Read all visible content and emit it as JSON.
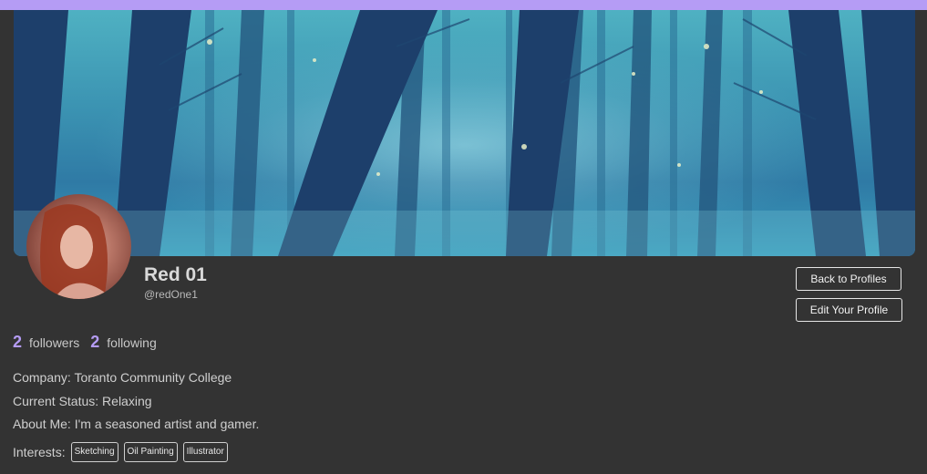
{
  "profile": {
    "name": "Red 01",
    "handle": "@redOne1",
    "followers_count": "2",
    "followers_label": "followers",
    "following_count": "2",
    "following_label": "following"
  },
  "actions": {
    "back_label": "Back to Profiles",
    "edit_label": "Edit Your Profile"
  },
  "details": {
    "company": "Company: Toranto Community College",
    "status": "Current Status: Relaxing",
    "about": "About Me: I'm a seasoned artist and gamer.",
    "interests_label": "Interests:",
    "interests": [
      "Sketching",
      "Oil Painting",
      "Illustrator"
    ]
  },
  "colors": {
    "accent": "#b59cf5",
    "background": "#333333"
  }
}
